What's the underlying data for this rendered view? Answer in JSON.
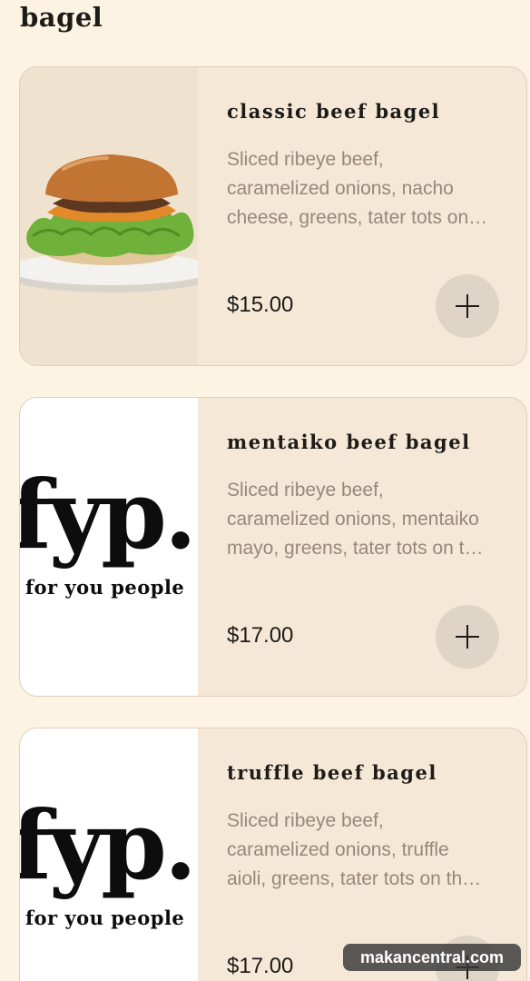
{
  "section": {
    "title": "bagel"
  },
  "items": [
    {
      "name": "classic beef bagel",
      "description": "Sliced ribeye beef,\ncaramelized onions, nacho\ncheese, greens, tater tots on…",
      "price": "$15.00",
      "image": "burger-photo"
    },
    {
      "name": "mentaiko beef bagel",
      "description": "Sliced ribeye beef,\ncaramelized onions, mentaiko\nmayo, greens, tater tots on t…",
      "price": "$17.00",
      "image": "fyp-logo",
      "logo": {
        "text": "fyp.",
        "subtitle": "for you people"
      }
    },
    {
      "name": "truffle beef bagel",
      "description": "Sliced ribeye beef,\ncaramelized onions, truffle\naioli, greens, tater tots on th…",
      "price": "$17.00",
      "image": "fyp-logo",
      "logo": {
        "text": "fyp.",
        "subtitle": "for you people"
      }
    }
  ],
  "add_icon": "plus-icon",
  "watermark": "makancentral.com",
  "colors": {
    "page_background": "#fdf3e2",
    "card_background": "#f5e8d6",
    "description_text": "#998779",
    "add_button": "#ded5c7"
  }
}
